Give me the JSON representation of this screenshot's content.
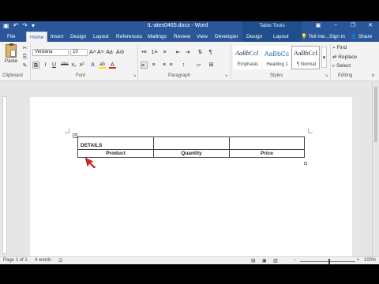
{
  "window": {
    "title": "IL-ates0465.docx - Word",
    "context_tab_group": "Table Tools",
    "minimize": "−",
    "restore": "❐",
    "close": "✕"
  },
  "qat": {
    "save": "▣",
    "undo": "↶",
    "redo": "↷",
    "customize": "▾"
  },
  "tabs": [
    {
      "label": "File"
    },
    {
      "label": "Home",
      "active": true
    },
    {
      "label": "Insert"
    },
    {
      "label": "Design"
    },
    {
      "label": "Layout"
    },
    {
      "label": "References"
    },
    {
      "label": "Mailings"
    },
    {
      "label": "Review"
    },
    {
      "label": "View"
    },
    {
      "label": "Developer"
    },
    {
      "label": "Design"
    },
    {
      "label": "Layout"
    }
  ],
  "tellme": "Tell me...",
  "signin": "Sign in",
  "share": "Share",
  "ribbon": {
    "paste_label": "Paste",
    "font_name": "Verdana",
    "font_size": "10",
    "bold": "B",
    "italic": "I",
    "underline": "U",
    "groups": {
      "clipboard": "Clipboard",
      "font": "Font",
      "paragraph": "Paragraph",
      "styles": "Styles",
      "editing": "Editing"
    },
    "styles": [
      {
        "sample": "AaBbCcI",
        "name": "Emphasis"
      },
      {
        "sample": "AaBbCc",
        "name": "Heading 1"
      },
      {
        "sample": "AaBbCcI",
        "name": "¶ Normal",
        "selected": true
      }
    ],
    "editing": {
      "find": "Find",
      "replace": "Replace",
      "select": "Select"
    },
    "font_grow": "A˄",
    "font_shrink": "A˅",
    "change_case": "Aa",
    "clear_format": "A⊘",
    "strikethrough": "abc",
    "subscript": "x₂",
    "superscript": "x²",
    "text_effects": "A",
    "highlight": "ab",
    "font_color": "A",
    "bullets": "•≡",
    "numbering": "1≡",
    "multilevel": "≡",
    "decrease_indent": "⇤",
    "increase_indent": "⇥",
    "sort": "⇅",
    "show_marks": "¶",
    "align_left": "≡",
    "align_center": "≡",
    "align_right": "≡",
    "justify": "≡",
    "line_spacing": "↕",
    "shading": "▱",
    "borders": "⊞",
    "cut": "✂",
    "copy": "⎘",
    "format_painter": "✎",
    "styles_more": "▾",
    "find_icon": "⌕",
    "replace_icon": "⇄",
    "select_icon": "▹",
    "collapse": "˄"
  },
  "document": {
    "table": {
      "rows": [
        [
          "DETAILS",
          "",
          ""
        ],
        [
          "Product",
          "Quantity",
          "Price"
        ]
      ]
    },
    "table_handle": "✛"
  },
  "status": {
    "page": "Page 1 of 1",
    "words": "4 words",
    "proofing": "☑",
    "zoom": "100%",
    "zoom_out": "−",
    "zoom_in": "+"
  },
  "colors": {
    "word_blue": "#2b579a",
    "context_tab": "#1e4e8c"
  }
}
